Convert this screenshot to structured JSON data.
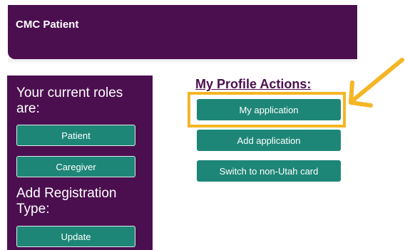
{
  "header": {
    "title": "CMC Patient"
  },
  "sidebar": {
    "roles_heading": "Your current roles are:",
    "roles": [
      {
        "label": "Patient"
      },
      {
        "label": "Caregiver"
      }
    ],
    "registration_heading": "Add Registration Type:",
    "update_label": "Update"
  },
  "actions": {
    "title": "My Profile Actions:",
    "buttons": [
      {
        "label": "My application"
      },
      {
        "label": "Add application"
      },
      {
        "label": "Switch to non-Utah card"
      }
    ]
  },
  "annotation": {
    "highlight_color": "#f4b625",
    "arrow_color": "#f4b625"
  },
  "colors": {
    "brand_purple": "#4b0f4f",
    "button_teal": "#1e8677"
  }
}
